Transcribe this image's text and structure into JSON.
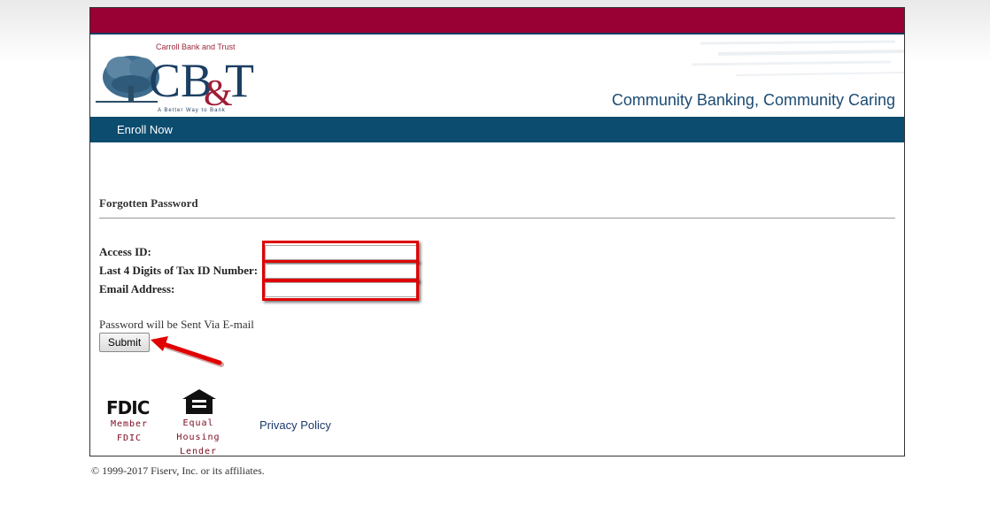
{
  "header": {
    "logo_top_text": "Carroll Bank and Trust",
    "logo_letters": "CB&T",
    "logo_bottom_text": "A Better Way to Bank",
    "tagline": "Community Banking, Community Caring",
    "brand_color": "#990033",
    "nav_color": "#0c4c6e"
  },
  "nav": {
    "enroll_label": "Enroll Now"
  },
  "form": {
    "title": "Forgotten Password",
    "fields": [
      {
        "label": "Access ID:",
        "value": ""
      },
      {
        "label": "Last 4 Digits of Tax ID Number:",
        "value": ""
      },
      {
        "label": "Email Address:",
        "value": ""
      }
    ],
    "note": "Password will be Sent Via E-mail",
    "submit_label": "Submit",
    "highlight_color": "#e00000"
  },
  "footer": {
    "fdic_logo_text": "FDIC",
    "fdic_caption_1": "Member",
    "fdic_caption_2": "FDIC",
    "eh_caption_1": "Equal",
    "eh_caption_2": "Housing",
    "eh_caption_3": "Lender",
    "privacy_label": "Privacy Policy",
    "copyright": "© 1999-2017 Fiserv, Inc. or its affiliates."
  }
}
